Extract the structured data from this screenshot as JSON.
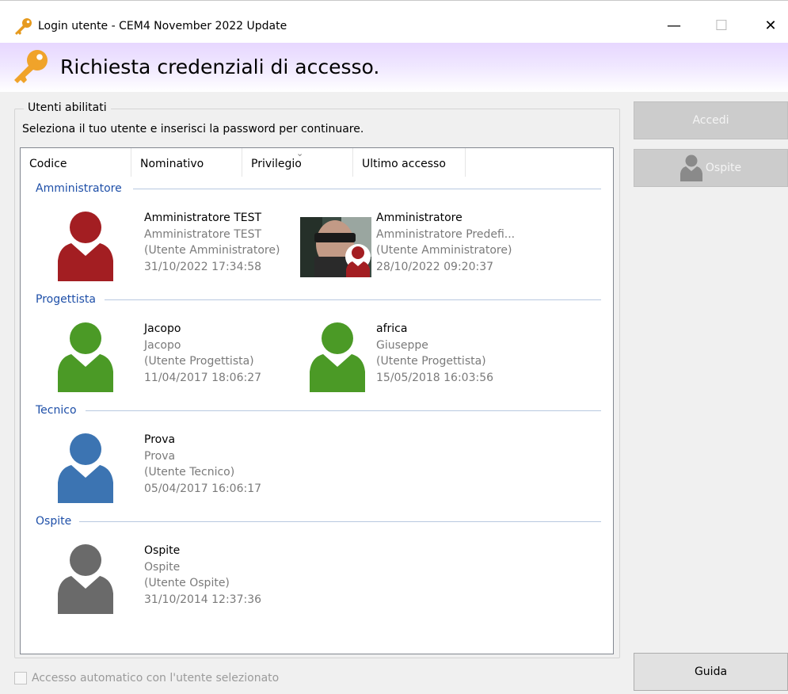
{
  "window": {
    "title": "Login utente - CEM4 November 2022 Update",
    "minimize": "—",
    "maximize": "☐",
    "close": "✕"
  },
  "header": {
    "title": "Richiesta credenziali di accesso."
  },
  "panel": {
    "legend": "Utenti abilitati",
    "instruction": "Seleziona il tuo utente e inserisci la password per continuare."
  },
  "columns": [
    "Codice",
    "Nominativo",
    "Privilegio",
    "Ultimo accesso"
  ],
  "groups": [
    {
      "name": "Amministratore",
      "users": [
        {
          "code": "Amministratore TEST",
          "fullname": "Amministratore TEST",
          "role": "(Utente Amministratore)",
          "last_access": "31/10/2022 17:34:58"
        },
        {
          "code": "Amministratore",
          "fullname": "Amministratore Predefi...",
          "role": "(Utente Amministratore)",
          "last_access": "28/10/2022 09:20:37"
        }
      ]
    },
    {
      "name": "Progettista",
      "users": [
        {
          "code": "Jacopo",
          "fullname": "Jacopo",
          "role": "(Utente Progettista)",
          "last_access": "11/04/2017 18:06:27"
        },
        {
          "code": "africa",
          "fullname": "Giuseppe",
          "role": "(Utente Progettista)",
          "last_access": "15/05/2018 16:03:56"
        }
      ]
    },
    {
      "name": "Tecnico",
      "users": [
        {
          "code": "Prova",
          "fullname": "Prova",
          "role": "(Utente Tecnico)",
          "last_access": "05/04/2017 16:06:17"
        }
      ]
    },
    {
      "name": "Ospite",
      "users": [
        {
          "code": "Ospite",
          "fullname": "Ospite",
          "role": "(Utente Ospite)",
          "last_access": "31/10/2014 12:37:36"
        }
      ]
    }
  ],
  "buttons": {
    "login": "Accedi",
    "guest": "Ospite",
    "help": "Guida"
  },
  "options": {
    "auto_login": "Accesso automatico con l'utente selezionato",
    "auto_login_checked": false
  },
  "colors": {
    "admin": "#a31e22",
    "designer": "#4b9a26",
    "technician": "#3c74b2",
    "guest": "#6a6a6a",
    "group_header": "#1e4fa8"
  },
  "icons": {
    "window": "key-icon",
    "header": "key-icon",
    "sort": "chevron-down-icon"
  }
}
